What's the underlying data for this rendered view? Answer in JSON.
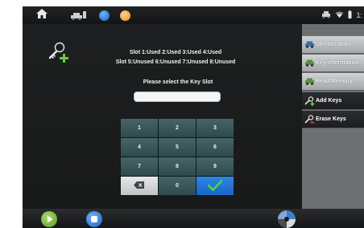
{
  "statusbar": {
    "icons": [
      "home-icon",
      "car-icon",
      "info-badge-icon",
      "orange-badge-icon",
      "bluetooth-car-icon",
      "wifi-icon",
      "battery-icon"
    ],
    "time": "1:"
  },
  "slots": {
    "line1": "Slot 1:Used 2:Used 3:Used 4:Used",
    "line2": "Slot 5:Unused 6:Unused 7:Unused 8:Unused"
  },
  "prompt": "Please select the Key Slot",
  "keyinput": {
    "value": ""
  },
  "keypad": {
    "keys": [
      "1",
      "2",
      "3",
      "4",
      "5",
      "6",
      "7",
      "8",
      "9",
      "",
      "0",
      ""
    ]
  },
  "sidebar": {
    "items": [
      {
        "label": "Identification",
        "icon": "car-identification-icon",
        "style": "light"
      },
      {
        "label": "Key information",
        "icon": "key-info-icon",
        "style": "light"
      },
      {
        "label": "Read Memory",
        "icon": "read-memory-icon",
        "style": "light"
      },
      {
        "label": "Add Keys",
        "icon": "add-key-icon",
        "style": "dark"
      },
      {
        "label": "Erase Keys",
        "icon": "erase-key-icon",
        "style": "dark"
      }
    ]
  },
  "colors": {
    "accent_blue": "#1f72d6",
    "play_green": "#7fbf3a",
    "add_green": "#5ed23a",
    "keypad_teal": "#3b585a"
  }
}
